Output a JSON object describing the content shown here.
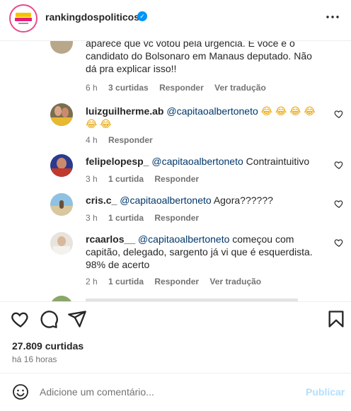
{
  "header": {
    "username": "rankingdospoliticos",
    "verified_icon": "verified-badge-icon",
    "more_icon": "more-options-icon"
  },
  "comments": [
    {
      "id": "c0",
      "text": "aparece que vc votou pela urgência. E você é o candidato do Bolsonaro em Manaus deputado. Não dá pra explicar isso!!",
      "meta_time": "6 h",
      "meta_likes": "3 curtidas",
      "reply": "Responder",
      "translate": "Ver tradução"
    },
    {
      "id": "c1",
      "username": "luizguilherme.ab",
      "mention": "@capitaoalbertoneto",
      "emoji_line1": "😂 😂 😂 😂",
      "emoji_line2": "😂 😂",
      "meta_time": "4 h",
      "reply": "Responder"
    },
    {
      "id": "c2",
      "username": "felipelopesp_",
      "mention": "@capitaoalbertoneto",
      "text": "Contraintuitivo",
      "meta_time": "3 h",
      "meta_likes": "1 curtida",
      "reply": "Responder"
    },
    {
      "id": "c3",
      "username": "cris.c_",
      "mention": "@capitaoalbertoneto",
      "text": "Agora??????",
      "meta_time": "3 h",
      "meta_likes": "1 curtida",
      "reply": "Responder"
    },
    {
      "id": "c4",
      "username": "rcaarlos__",
      "mention": "@capitaoalbertoneto",
      "text": "começou com capitão, delegado, sargento já vi que é esquerdista. 98% de acerto",
      "meta_time": "2 h",
      "meta_likes": "1 curtida",
      "reply": "Responder",
      "translate": "Ver tradução"
    }
  ],
  "actions": {
    "like_icon": "heart-icon",
    "comment_icon": "comment-bubble-icon",
    "share_icon": "paper-plane-icon",
    "save_icon": "bookmark-icon"
  },
  "post": {
    "likes": "27.809 curtidas",
    "time": "há 16 horas"
  },
  "composer": {
    "placeholder": "Adicione um comentário...",
    "publish_label": "Publicar"
  },
  "colors": {
    "mention": "#00376b",
    "meta": "#737373",
    "verified": "#0095f6",
    "publish_disabled": "#b2dffc"
  }
}
